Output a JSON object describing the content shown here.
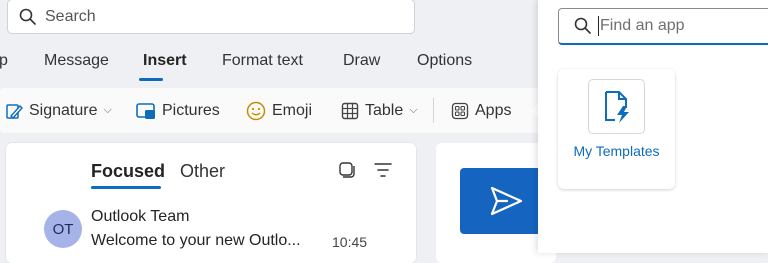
{
  "search": {
    "placeholder": "Search"
  },
  "tabs": [
    {
      "label": "p"
    },
    {
      "label": "Message"
    },
    {
      "label": "Insert",
      "active": true
    },
    {
      "label": "Format text"
    },
    {
      "label": "Draw"
    },
    {
      "label": "Options"
    }
  ],
  "toolbar": {
    "signature": "Signature",
    "pictures": "Pictures",
    "emoji": "Emoji",
    "table": "Table",
    "apps": "Apps"
  },
  "mail_list": {
    "focused": "Focused",
    "other": "Other",
    "items": [
      {
        "initials": "OT",
        "sender": "Outlook Team",
        "preview": "Welcome to your new Outlo...",
        "time": "10:45"
      }
    ]
  },
  "app_flyout": {
    "find_placeholder": "Find an app",
    "apps": [
      {
        "name": "My Templates",
        "icon": "document-lightning-icon"
      }
    ]
  },
  "colors": {
    "accent": "#0f6cbd",
    "avatar_bg": "#a6b3e8",
    "send_tile": "#1565c0"
  }
}
